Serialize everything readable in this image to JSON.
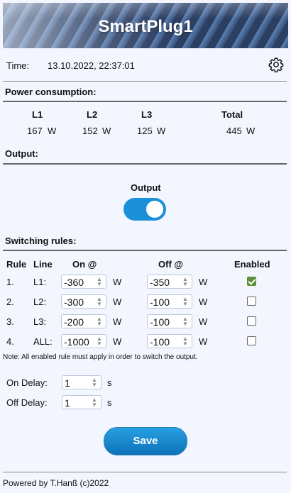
{
  "app": {
    "title": "SmartPlug1"
  },
  "time": {
    "label": "Time:",
    "value": "13.10.2022, 22:37:01"
  },
  "power": {
    "section": "Power consumption:",
    "headers": [
      "L1",
      "L2",
      "L3",
      "Total"
    ],
    "values": [
      "167",
      "152",
      "125",
      "445"
    ],
    "unit": "W"
  },
  "output": {
    "section": "Output:",
    "toggle_label": "Output",
    "state_on": true
  },
  "rules": {
    "section": "Switching rules:",
    "headers": {
      "rule": "Rule",
      "line": "Line",
      "on": "On @",
      "off": "Off @",
      "enabled": "Enabled"
    },
    "unit": "W",
    "items": [
      {
        "rule": "1.",
        "line": "L1:",
        "on": "-360",
        "off": "-350",
        "enabled": true
      },
      {
        "rule": "2.",
        "line": "L2:",
        "on": "-300",
        "off": "-100",
        "enabled": false
      },
      {
        "rule": "3.",
        "line": "L3:",
        "on": "-200",
        "off": "-100",
        "enabled": false
      },
      {
        "rule": "4.",
        "line": "ALL:",
        "on": "-1000",
        "off": "-100",
        "enabled": false
      }
    ],
    "note": "Note: All enabled rule must apply in order to switch the output."
  },
  "delays": {
    "on_label": "On Delay:",
    "on_value": "1",
    "off_label": "Off Delay:",
    "off_value": "1",
    "unit": "s"
  },
  "save_label": "Save",
  "footer": "Powered by T.Hanß (c)2022",
  "colors": {
    "accent": "#1b8fd8",
    "checkbox_on": "#5f8f3a",
    "background": "#f3f6ff"
  },
  "icons": {
    "settings": "gear-icon"
  }
}
